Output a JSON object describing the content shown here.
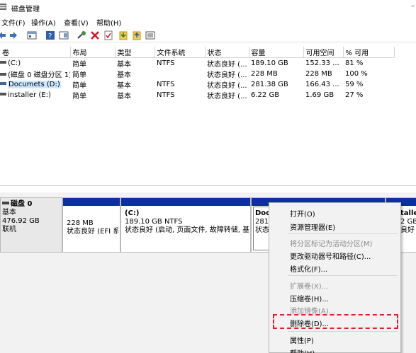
{
  "window": {
    "title": "磁盘管理",
    "minimize": "–"
  },
  "menu": {
    "items": [
      "文件(F)",
      "操作(A)",
      "查看(V)",
      "帮助(H)"
    ]
  },
  "table": {
    "headers": [
      "卷",
      "布局",
      "类型",
      "文件系统",
      "状态",
      "容量",
      "可用空间",
      "% 可用"
    ],
    "rows": [
      [
        "(C:)",
        "简单",
        "基本",
        "NTFS",
        "状态良好 (...",
        "189.10 GB",
        "152.33 ...",
        "81 %"
      ],
      [
        "(磁盘 0 磁盘分区 1)",
        "简单",
        "基本",
        "",
        "状态良好 (...",
        "228 MB",
        "228 MB",
        "100 %"
      ],
      [
        "Documets (D:)",
        "简单",
        "基本",
        "NTFS",
        "状态良好 (...",
        "281.38 GB",
        "166.43 ...",
        "59 %"
      ],
      [
        "installer (E:)",
        "简单",
        "基本",
        "NTFS",
        "状态良好 (...",
        "6.22 GB",
        "1.69 GB",
        "27 %"
      ]
    ]
  },
  "disk": {
    "name": "磁盘 0",
    "type": "基本",
    "size": "476.92 GB",
    "status": "联机"
  },
  "partitions": {
    "efi": {
      "size": "228 MB",
      "status": "状态良好 (EFI 系"
    },
    "c": {
      "name": "(C:)",
      "size": "189.10 GB NTFS",
      "status": "状态良好 (启动, 页面文件, 故障转储, 基本"
    },
    "d": {
      "name": "Doc",
      "size": "281.",
      "status": "状态"
    },
    "e": {
      "name": "talle",
      "size": "2 GB",
      "status": "良好"
    }
  },
  "context_menu": {
    "open": "打开(O)",
    "explorer": "资源管理器(E)",
    "mark_active": "将分区标记为活动分区(M)",
    "change_letter": "更改驱动器号和路径(C)...",
    "format": "格式化(F)...",
    "extend": "扩展卷(X)...",
    "shrink": "压缩卷(H)...",
    "mirror": "添加镜像(A)...",
    "delete": "删除卷(D)...",
    "properties": "属性(P)",
    "help": "帮助(H)"
  },
  "colors": {
    "partition_bar": "#0c2fa3",
    "highlight": "#e0202a",
    "selection": "#cde8ff"
  }
}
